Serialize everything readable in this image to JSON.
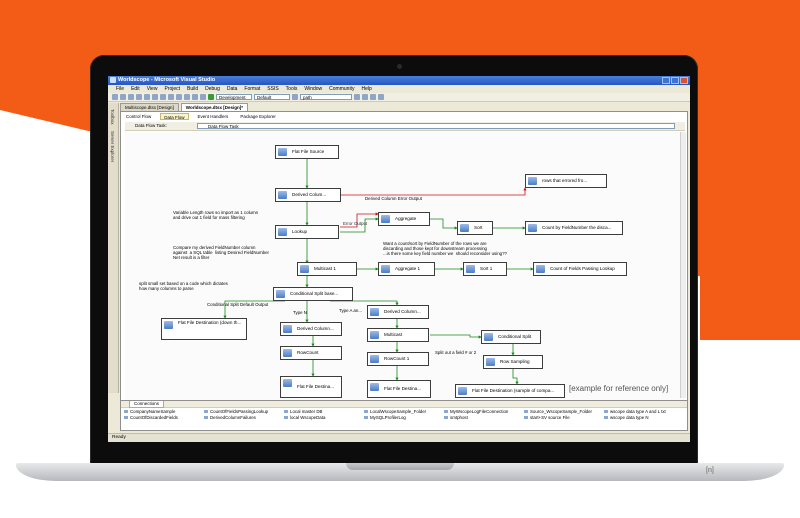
{
  "window": {
    "title": "Worldscope - Microsoft Visual Studio"
  },
  "menu": [
    "File",
    "Edit",
    "View",
    "Project",
    "Build",
    "Debug",
    "Data",
    "Format",
    "SSIS",
    "Tools",
    "Window",
    "Community",
    "Help"
  ],
  "toolbar": {
    "configuration": "Development",
    "platform": "Default",
    "find": "path"
  },
  "document_tabs": [
    "Multiscope.dtsx [Design]",
    "Worldscope.dtsx [Design]*"
  ],
  "sidebar": [
    "Toolbox",
    "Server Explorer"
  ],
  "designer_tabs": [
    "Control Flow",
    "Data Flow",
    "Event Handlers",
    "Package Explorer"
  ],
  "active_designer_tab": "Data Flow",
  "data_flow_task": {
    "label": "Data Flow Task:",
    "value": "Data Flow Task"
  },
  "components": {
    "flat_file_source": "Flat File Source",
    "derived_column_1": "Derived Colum...",
    "rows_errored": "rows that errored fro...",
    "lookup": "Lookup",
    "aggregate_1": "Aggregate",
    "sort_1": "Sort",
    "count_by_field": "Count by FieldNumber the disca...",
    "multicast_1": "Multicast 1",
    "aggregate_2": "Aggregate 1",
    "sort_2": "Sort 1",
    "count_fields_lookup": "Count of Fields Passing Lookup",
    "conditional_split_base": "Conditional Split base...",
    "flat_file_dest_down": "Flat File Destination (down th...",
    "derived_column_2": "Derived Column...",
    "derived_column_3": "Derived Column...",
    "rowcount": "RowCount",
    "multicast_2": "Multicast",
    "rowcount_1": "RowCount 1",
    "conditional_split": "Conditional Split",
    "row_sampling": "Row Sampling",
    "flat_file_dest_1": "Flat File Destina...",
    "flat_file_dest_2": "Flat File Destina...",
    "flat_file_dest_sample": "Flat File Destination (sample of compa..."
  },
  "flow_labels": {
    "derived_error": "Derived Column Error Output",
    "error_output": "Error Output",
    "cond_default": "Conditional Split Default Output",
    "type_n": "Type N",
    "type_a": "Type A an...",
    "split_field": "Split out a field # or 2"
  },
  "notes": {
    "variable_length": "Variable Length rows so import as 1 column\nand drive out 1 field for mass filtering",
    "compare": "Compare my derived FieldNumber column\nagainst  a SQL table  listing Desired FieldNumber\nNet result is a filter",
    "split_small": "split small set based on a code which dictates\nhow many columns to parse",
    "want_count": "Want a count/sort by FieldNumber of the rows we are\ndiscarding and those kept for downstream processing\n...is there some key field number we  should reconsider using??"
  },
  "watermark": "[example for reference only]",
  "connections": {
    "tab": "Connections",
    "items": [
      "CompanyNameSample",
      "CountOfFieldsPassingLookup",
      "Local master DB",
      "LocalWscopeSample_Folder",
      "MyWscopeLogFileConnection",
      "Source_WscopeSample_Folder",
      "wscope data type A and L txt",
      "CountOfDiscardedFields",
      "DerivedColumnFailures",
      "local WscopeData",
      "MySQLProfilerLog",
      "smtphost",
      "start+SV source File",
      "wscope data type N"
    ]
  },
  "status": "Ready",
  "laptop_logo": "[n]",
  "colors": {
    "background_accent": "#f25c16",
    "titlebar": "#2456c5",
    "flow_green": "#1a8a1a",
    "flow_red": "#d01010"
  }
}
